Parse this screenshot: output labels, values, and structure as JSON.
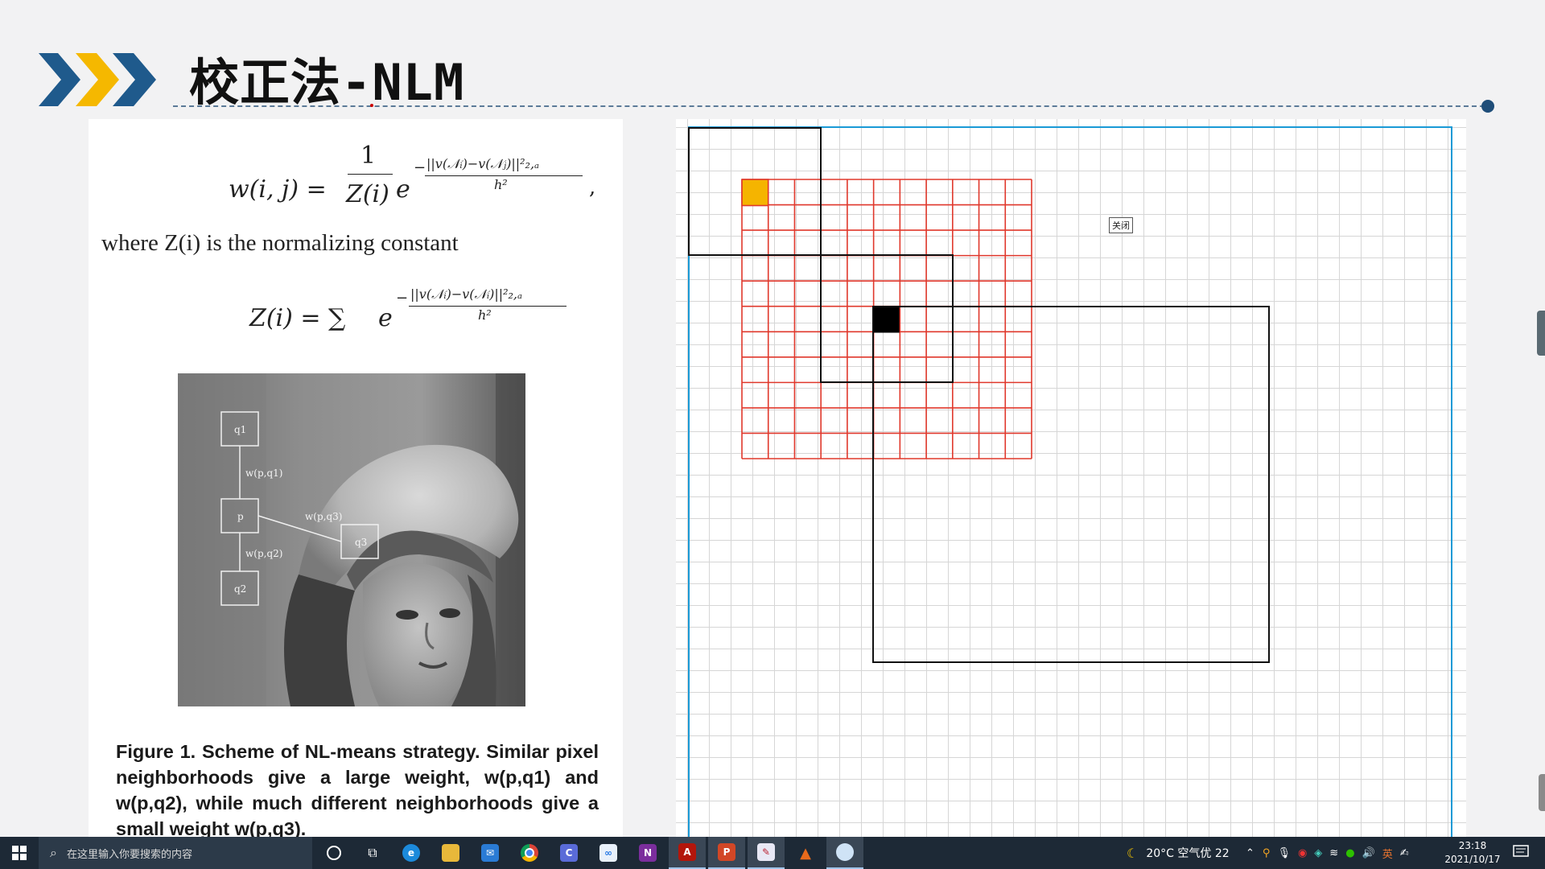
{
  "slide": {
    "title": "校正法-NLM",
    "accent_colors": {
      "dark_blue": "#1f5a8c",
      "yellow": "#f5b800"
    }
  },
  "paper": {
    "eq1_lhs": "w(i, j) =",
    "eq1_num": "1",
    "eq1_den": "Z(i)",
    "eq1_base": "e",
    "eq1_exp_num": "||v(𝒩ᵢ)−v(𝒩ⱼ)||²₂,ₐ",
    "eq1_exp_den": "h²",
    "eq1_comma": ",",
    "where_text": "where Z(i) is the normalizing constant",
    "eq2_lhs": "Z(i) = ∑",
    "eq2_base": "e",
    "eq2_exp_num": "||v(𝒩ᵢ)−v(𝒩ᵢ)||²₂,ₐ",
    "eq2_exp_den": "h²",
    "figure_labels": {
      "q1": "q1",
      "p": "p",
      "q2": "q2",
      "q3": "q3",
      "w_pq1": "w(p,q1)",
      "w_pq2": "w(p,q2)",
      "w_pq3": "w(p,q3)"
    },
    "caption": "Figure 1. Scheme of NL-means strategy.  Similar pixel neighborhoods give a large weight, w(p,q1) and w(p,q2), while much different neighborhoods give a small weight w(p,q3)."
  },
  "canvas": {
    "close_label": "关闭",
    "colors": {
      "grid_red": "#e0382c",
      "highlight_orange": "#f5b400",
      "center_black": "#000000",
      "frame_blue": "#1a9ad6"
    }
  },
  "taskbar": {
    "search_placeholder": "在这里输入你要搜索的内容",
    "weather": "20°C  空气优 22",
    "time": "23:18",
    "date": "2021/10/17",
    "apps": [
      "cortana-icon",
      "task-view-icon",
      "edge-icon",
      "file-explorer-icon",
      "mail-icon",
      "chrome-icon",
      "app-icon",
      "baidu-netdisk-icon",
      "onenote-icon",
      "acrobat-icon",
      "powerpoint-icon",
      "paint-icon",
      "matlab-icon",
      "browser-icon"
    ]
  }
}
